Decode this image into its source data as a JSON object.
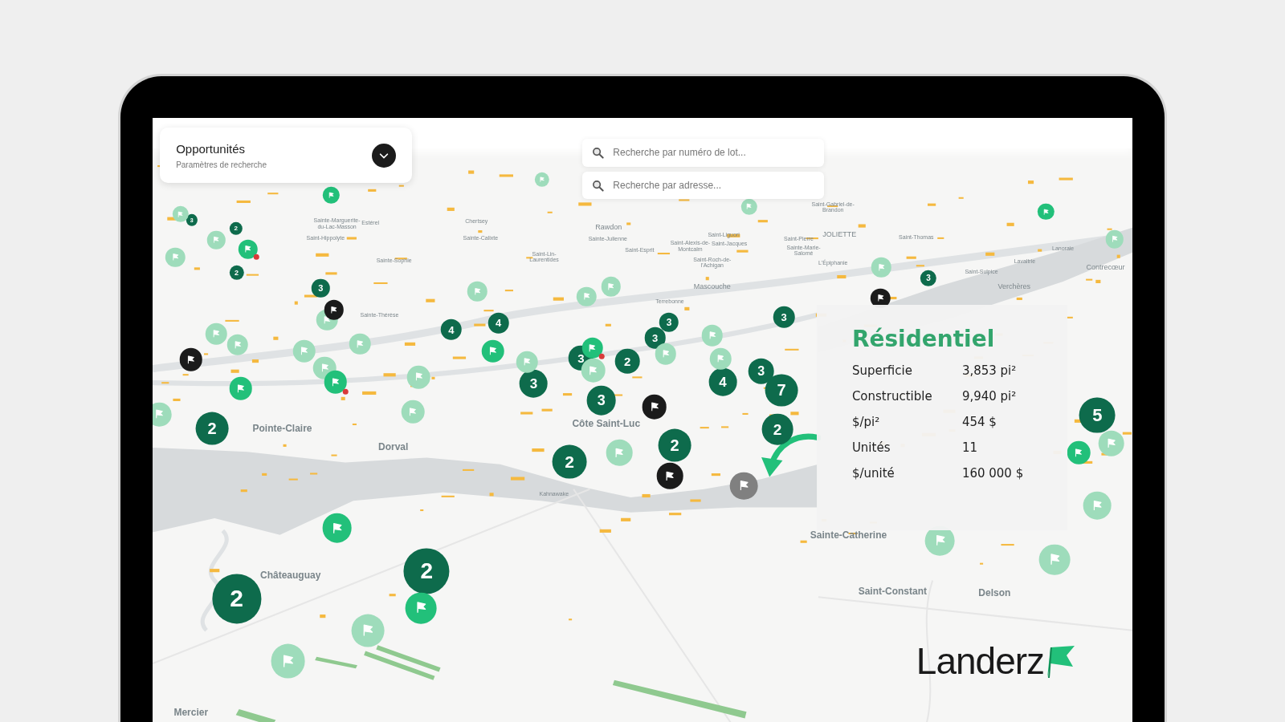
{
  "filter_panel": {
    "title": "Opportunités",
    "subtitle": "Paramètres de recherche"
  },
  "search_fields": [
    {
      "placeholder": "Recherche par numéro de lot..."
    },
    {
      "placeholder": "Recherche par adresse..."
    }
  ],
  "map_labels": [
    "Sainte-Marguerite-du-Lac-Masson",
    "Estérel",
    "Chertsey",
    "Rawdon",
    "Saint-Hippolyte",
    "Sainte-Calixte",
    "Sainte-Julienne",
    "Saint-Liguori",
    "Saint-Gabriel-de-Brandon",
    "Saint-Pierre",
    "JOLIETTE",
    "Saint-Alexis-de-Montcalm",
    "Saint-Jacques",
    "Sainte-Marie-Salomé",
    "Saint-Thomas",
    "Saint-Esprit",
    "Sainte-Sophie",
    "Saint-Lin-Laurentides",
    "Saint-Roch-de-l'Achigan",
    "L'Épiphanie",
    "Lanoraie",
    "Lavaltrie",
    "Saint-Sulpice",
    "Contrecœur",
    "Verchères",
    "Mascouche",
    "Terrebonne",
    "Sainte-Thérèse",
    "Pointe-Claire",
    "Dorval",
    "Côte Saint-Luc",
    "Kahnawake",
    "Sainte-Catherine",
    "Châteauguay",
    "Saint-Constant",
    "Delson",
    "Mercier"
  ],
  "clusters": [
    {
      "count": "3"
    },
    {
      "count": "2"
    },
    {
      "count": "2"
    },
    {
      "count": "3"
    },
    {
      "count": "4"
    },
    {
      "count": "4"
    },
    {
      "count": "3"
    },
    {
      "count": "2"
    },
    {
      "count": "3"
    },
    {
      "count": "3"
    },
    {
      "count": "3"
    },
    {
      "count": "3"
    },
    {
      "count": "4"
    },
    {
      "count": "3"
    },
    {
      "count": "3"
    },
    {
      "count": "7"
    },
    {
      "count": "2"
    },
    {
      "count": "2"
    },
    {
      "count": "2"
    },
    {
      "count": "2"
    },
    {
      "count": "3"
    },
    {
      "count": "5"
    },
    {
      "count": "2"
    },
    {
      "count": "2"
    }
  ],
  "flags": [
    {
      "color": "#9edcbb",
      "alert": false
    },
    {
      "color": "#9edcbb",
      "alert": false
    },
    {
      "color": "#9edcbb",
      "alert": false
    },
    {
      "color": "#22c07a",
      "alert": false
    },
    {
      "color": "#22c07a",
      "alert": true
    },
    {
      "color": "#9edcbb",
      "alert": false
    },
    {
      "color": "#9edcbb",
      "alert": false
    },
    {
      "color": "#9edcbb",
      "alert": false
    },
    {
      "color": "#9edcbb",
      "alert": false
    },
    {
      "color": "#9edcbb",
      "alert": false
    },
    {
      "color": "#9edcbb",
      "alert": false
    },
    {
      "color": "#9edcbb",
      "alert": false
    },
    {
      "color": "#9edcbb",
      "alert": false
    },
    {
      "color": "#9edcbb",
      "alert": false
    },
    {
      "color": "#9edcbb",
      "alert": false
    },
    {
      "color": "#9edcbb",
      "alert": false
    },
    {
      "color": "#9edcbb",
      "alert": false
    },
    {
      "color": "#9edcbb",
      "alert": false
    },
    {
      "color": "#9edcbb",
      "alert": false
    },
    {
      "color": "#9edcbb",
      "alert": false
    },
    {
      "color": "#9edcbb",
      "alert": false
    },
    {
      "color": "#9edcbb",
      "alert": false
    },
    {
      "color": "#9edcbb",
      "alert": false
    },
    {
      "color": "#9edcbb",
      "alert": false
    },
    {
      "color": "#9edcbb",
      "alert": false
    },
    {
      "color": "#9edcbb",
      "alert": false
    },
    {
      "color": "#9edcbb",
      "alert": false
    },
    {
      "color": "#9edcbb",
      "alert": false
    },
    {
      "color": "#9edcbb",
      "alert": false
    },
    {
      "color": "#9edcbb",
      "alert": false
    },
    {
      "color": "#9edcbb",
      "alert": false
    },
    {
      "color": "#9edcbb",
      "alert": false
    },
    {
      "color": "#9edcbb",
      "alert": false
    },
    {
      "color": "#22c07a",
      "alert": false
    },
    {
      "color": "#22c07a",
      "alert": false
    },
    {
      "color": "#22c07a",
      "alert": true
    },
    {
      "color": "#22c07a",
      "alert": false
    },
    {
      "color": "#22c07a",
      "alert": true
    },
    {
      "color": "#22c07a",
      "alert": false
    },
    {
      "color": "#22c07a",
      "alert": false
    },
    {
      "color": "#22c07a",
      "alert": false
    },
    {
      "color": "#1b1b1b",
      "alert": false
    },
    {
      "color": "#1b1b1b",
      "alert": false
    },
    {
      "color": "#1b1b1b",
      "alert": false
    },
    {
      "color": "#1b1b1b",
      "alert": false
    },
    {
      "color": "#1b1b1b",
      "alert": false
    },
    {
      "color": "#808080",
      "alert": false
    }
  ],
  "property_card": {
    "title": "Résidentiel",
    "rows": [
      {
        "label": "Superficie",
        "value": "3,853 pi²"
      },
      {
        "label": "Constructible",
        "value": "9,940 pi²"
      },
      {
        "label": "$/pi²",
        "value": "454 $"
      },
      {
        "label": "Unités",
        "value": "11"
      },
      {
        "label": "$/unité",
        "value": "160 000 $"
      }
    ]
  },
  "logo": {
    "text": "Landerz"
  }
}
